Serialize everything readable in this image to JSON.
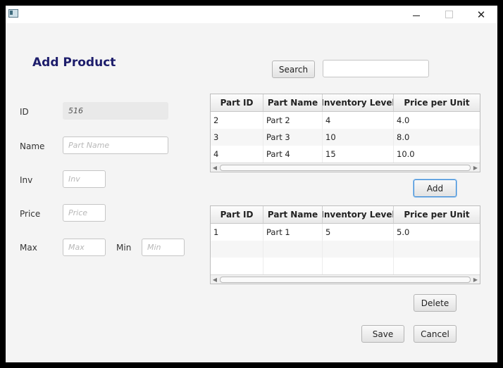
{
  "window": {
    "app_icon": "app-window-icon"
  },
  "form": {
    "title": "Add Product",
    "id_label": "ID",
    "id_value": "516",
    "name_label": "Name",
    "name_placeholder": "Part Name",
    "inv_label": "Inv",
    "inv_placeholder": "Inv",
    "price_label": "Price",
    "price_placeholder": "Price",
    "max_label": "Max",
    "max_placeholder": "Max",
    "min_label": "Min",
    "min_placeholder": "Min"
  },
  "search": {
    "button_label": "Search",
    "value": ""
  },
  "columns": [
    "Part ID",
    "Part Name",
    "Inventory Level",
    "Price per Unit"
  ],
  "available_parts": [
    [
      "2",
      "Part 2",
      "4",
      "4.0"
    ],
    [
      "3",
      "Part 3",
      "10",
      "8.0"
    ],
    [
      "4",
      "Part 4",
      "15",
      "10.0"
    ]
  ],
  "associated_parts": [
    [
      "1",
      "Part 1",
      "5",
      "5.0"
    ],
    [
      "",
      "",
      "",
      ""
    ],
    [
      "",
      "",
      "",
      ""
    ]
  ],
  "buttons": {
    "add": "Add",
    "delete": "Delete",
    "save": "Save",
    "cancel": "Cancel"
  }
}
